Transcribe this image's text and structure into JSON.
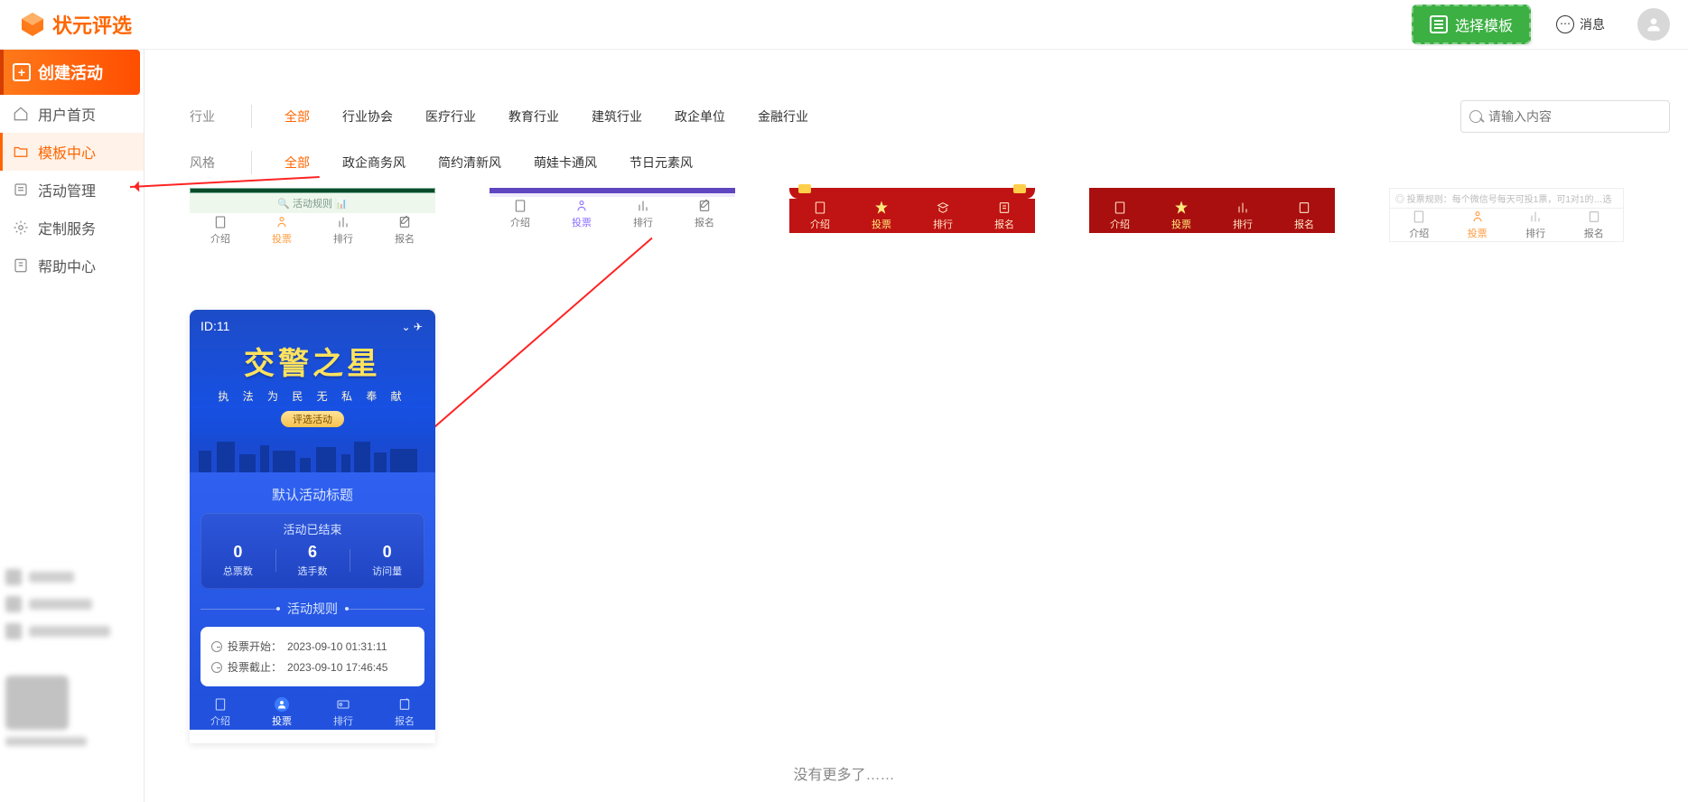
{
  "header": {
    "logo_text": "状元评选",
    "choose_template": "选择模板",
    "messages": "消息"
  },
  "sidebar": {
    "create": "创建活动",
    "items": [
      {
        "label": "用户首页",
        "icon": "home"
      },
      {
        "label": "模板中心",
        "icon": "folder",
        "active": true
      },
      {
        "label": "活动管理",
        "icon": "list"
      },
      {
        "label": "定制服务",
        "icon": "gear"
      },
      {
        "label": "帮助中心",
        "icon": "help"
      }
    ]
  },
  "filters": {
    "industry_label": "行业",
    "industry": [
      "全部",
      "行业协会",
      "医疗行业",
      "教育行业",
      "建筑行业",
      "政企单位",
      "金融行业"
    ],
    "style_label": "风格",
    "style": [
      "全部",
      "政企商务风",
      "简约清新风",
      "萌娃卡通风",
      "节日元素风"
    ],
    "search_placeholder": "请输入内容"
  },
  "stubs": {
    "nav": [
      "介绍",
      "投票",
      "排行",
      "报名"
    ],
    "rule_text": "活动规则",
    "rule_hint": "◎ 投票规则：每个微信号每天可投1票，可1对1的…选"
  },
  "feature": {
    "id": "ID:11",
    "title": "交警之星",
    "subtitle": "执 法 为 民  无 私 奉 献",
    "badge": "评选活动",
    "default_title": "默认活动标题",
    "ended": "活动已结束",
    "stats": [
      {
        "num": "0",
        "label": "总票数"
      },
      {
        "num": "6",
        "label": "选手数"
      },
      {
        "num": "0",
        "label": "访问量"
      }
    ],
    "rules_title": "活动规则",
    "times": [
      {
        "label": "投票开始：",
        "value": "2023-09-10 01:31:11"
      },
      {
        "label": "投票截止：",
        "value": "2023-09-10 17:46:45"
      }
    ],
    "nav": [
      "介绍",
      "投票",
      "排行",
      "报名"
    ]
  },
  "footer": {
    "no_more": "没有更多了……"
  }
}
